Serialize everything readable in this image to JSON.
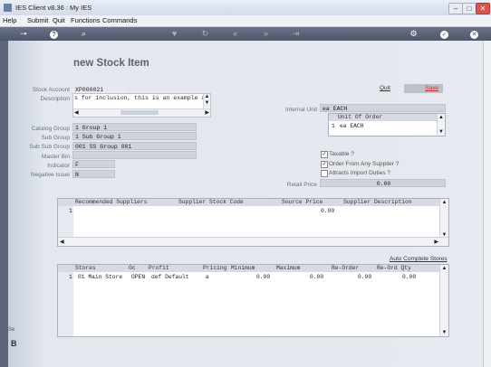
{
  "window": {
    "title": "IES Client v8.36 : My IES",
    "min": "–",
    "max": "□",
    "close": "✕"
  },
  "menu": [
    "Help",
    "Submit",
    "Quit",
    "Functions",
    "Commands"
  ],
  "toolbar": {
    "icons": [
      "key-icon",
      "help-icon",
      "search-icon",
      "heart-icon",
      "refresh-icon",
      "rewind-icon",
      "fast-forward-icon",
      "end-icon",
      "settings-icon",
      "check-icon",
      "close-icon"
    ]
  },
  "form": {
    "title": "new Stock Item",
    "quit": "Quit",
    "save": "Save"
  },
  "fields": {
    "stock_account": {
      "label": "Stock Account",
      "value": "XP000021"
    },
    "description": {
      "label": "Description",
      "value": "s for inclusion, this is an example only."
    },
    "catalog_group": {
      "label": "Catalog Group",
      "value": "1 Group 1"
    },
    "sub_group": {
      "label": "Sub Group",
      "value": "1 Sub Group 1"
    },
    "sub_sub_group": {
      "label": "Sub Sub Group",
      "value": "001 SS Group 001"
    },
    "master_bin": {
      "label": "Master Bin",
      "value": ""
    },
    "indicator": {
      "label": "Indicator",
      "value": "F"
    },
    "negative_issue": {
      "label": "Negative Issue",
      "value": "N"
    },
    "internal_unit": {
      "label": "Internal Unit",
      "value": "ea EACH"
    },
    "retail_price": {
      "label": "Retail Price",
      "value": "0.00"
    }
  },
  "unit_of_order": {
    "header": "Unit Of Order",
    "rows": [
      {
        "n": "1",
        "value": "ea EACH"
      }
    ]
  },
  "checks": [
    {
      "label": "Taxable ?",
      "checked": true
    },
    {
      "label": "Order From Any Supplier ?",
      "checked": true
    },
    {
      "label": "Attracts Import Duties ?",
      "checked": false
    }
  ],
  "suppliers": {
    "headers": [
      "Recommended Suppliers",
      "Supplier Stock Code",
      "Source Price",
      "Supplier Description"
    ],
    "rows": [
      {
        "n": "1",
        "supplier": "",
        "code": "",
        "price": "0.00",
        "desc": ""
      }
    ]
  },
  "stores": {
    "link": "Auto Complete Stores",
    "headers": [
      "Stores",
      "Oc",
      "Profit",
      "Pricing",
      "Minimum",
      "Maximum",
      "Re-Order",
      "Re-Ord Qty"
    ],
    "rows": [
      {
        "n": "1",
        "store": "01 Main Store",
        "oc": "OPEN",
        "profit": "def Default",
        "pricing": "a",
        "min": "0.00",
        "max": "0.00",
        "reorder": "0.00",
        "reordqty": "0.00"
      }
    ]
  },
  "side_text": "Se"
}
